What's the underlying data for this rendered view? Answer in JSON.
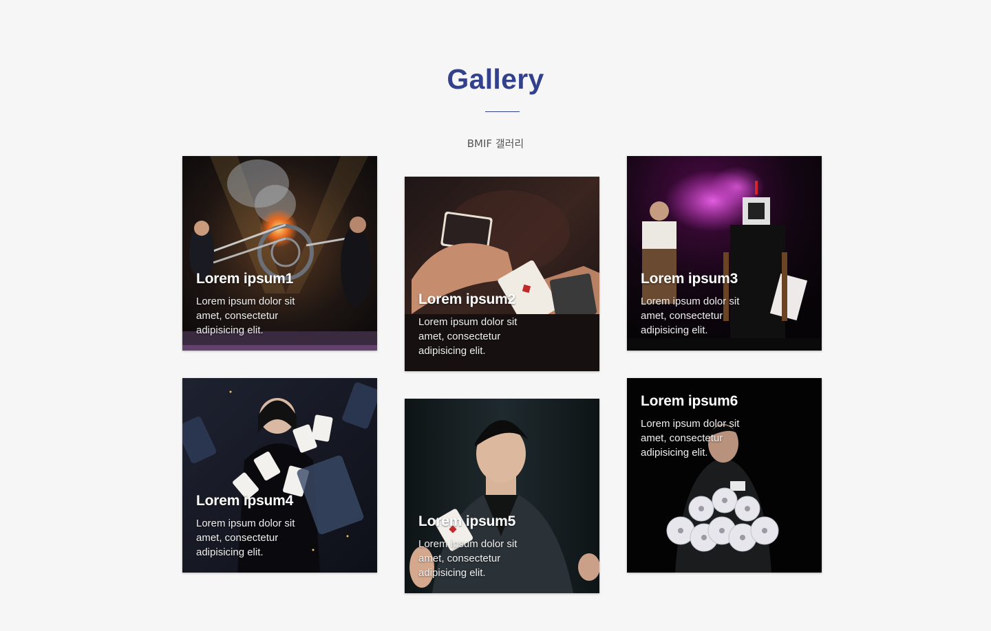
{
  "header": {
    "title": "Gallery",
    "subtitle": "BMIF 갤러리"
  },
  "gallery": [
    {
      "title": "Lorem ipsum1",
      "text": "Lorem ipsum dolor sit amet, consectetur adipisicing elit."
    },
    {
      "title": "Lorem ipsum2",
      "text": "Lorem ipsum dolor sit amet, consectetur adipisicing elit."
    },
    {
      "title": "Lorem ipsum3",
      "text": "Lorem ipsum dolor sit amet, consectetur adipisicing elit."
    },
    {
      "title": "Lorem ipsum4",
      "text": "Lorem ipsum dolor sit amet, consectetur adipisicing elit."
    },
    {
      "title": "Lorem ipsum5",
      "text": "Lorem ipsum dolor sit amet, consectetur adipisicing elit."
    },
    {
      "title": "Lorem ipsum6",
      "text": "Lorem ipsum dolor sit amet, consectetur adipisicing elit."
    }
  ],
  "colors": {
    "accent": "#33418c",
    "background": "#f6f6f7"
  }
}
